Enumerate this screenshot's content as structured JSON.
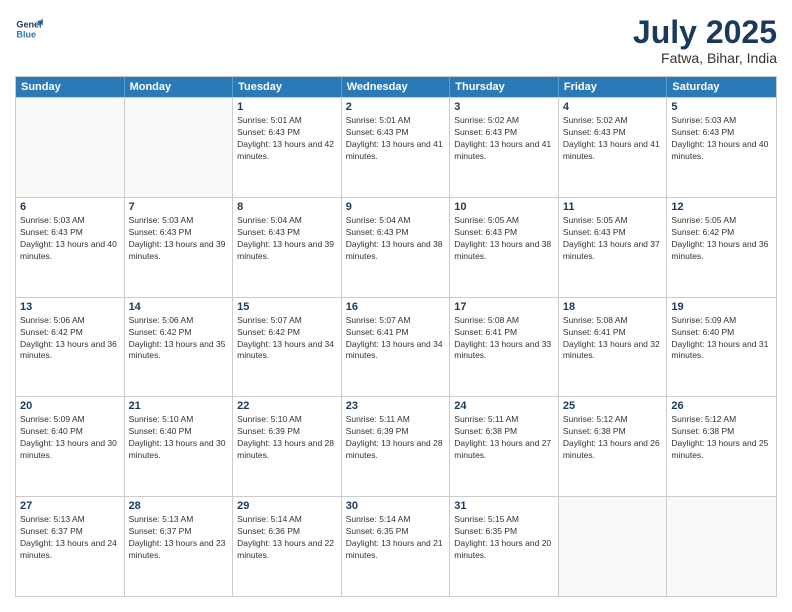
{
  "header": {
    "logo_general": "General",
    "logo_blue": "Blue",
    "month": "July 2025",
    "location": "Fatwa, Bihar, India"
  },
  "weekdays": [
    "Sunday",
    "Monday",
    "Tuesday",
    "Wednesday",
    "Thursday",
    "Friday",
    "Saturday"
  ],
  "rows": [
    [
      {
        "day": "",
        "sunrise": "",
        "sunset": "",
        "daylight": "",
        "empty": true
      },
      {
        "day": "",
        "sunrise": "",
        "sunset": "",
        "daylight": "",
        "empty": true
      },
      {
        "day": "1",
        "sunrise": "Sunrise: 5:01 AM",
        "sunset": "Sunset: 6:43 PM",
        "daylight": "Daylight: 13 hours and 42 minutes.",
        "empty": false
      },
      {
        "day": "2",
        "sunrise": "Sunrise: 5:01 AM",
        "sunset": "Sunset: 6:43 PM",
        "daylight": "Daylight: 13 hours and 41 minutes.",
        "empty": false
      },
      {
        "day": "3",
        "sunrise": "Sunrise: 5:02 AM",
        "sunset": "Sunset: 6:43 PM",
        "daylight": "Daylight: 13 hours and 41 minutes.",
        "empty": false
      },
      {
        "day": "4",
        "sunrise": "Sunrise: 5:02 AM",
        "sunset": "Sunset: 6:43 PM",
        "daylight": "Daylight: 13 hours and 41 minutes.",
        "empty": false
      },
      {
        "day": "5",
        "sunrise": "Sunrise: 5:03 AM",
        "sunset": "Sunset: 6:43 PM",
        "daylight": "Daylight: 13 hours and 40 minutes.",
        "empty": false
      }
    ],
    [
      {
        "day": "6",
        "sunrise": "Sunrise: 5:03 AM",
        "sunset": "Sunset: 6:43 PM",
        "daylight": "Daylight: 13 hours and 40 minutes.",
        "empty": false
      },
      {
        "day": "7",
        "sunrise": "Sunrise: 5:03 AM",
        "sunset": "Sunset: 6:43 PM",
        "daylight": "Daylight: 13 hours and 39 minutes.",
        "empty": false
      },
      {
        "day": "8",
        "sunrise": "Sunrise: 5:04 AM",
        "sunset": "Sunset: 6:43 PM",
        "daylight": "Daylight: 13 hours and 39 minutes.",
        "empty": false
      },
      {
        "day": "9",
        "sunrise": "Sunrise: 5:04 AM",
        "sunset": "Sunset: 6:43 PM",
        "daylight": "Daylight: 13 hours and 38 minutes.",
        "empty": false
      },
      {
        "day": "10",
        "sunrise": "Sunrise: 5:05 AM",
        "sunset": "Sunset: 6:43 PM",
        "daylight": "Daylight: 13 hours and 38 minutes.",
        "empty": false
      },
      {
        "day": "11",
        "sunrise": "Sunrise: 5:05 AM",
        "sunset": "Sunset: 6:43 PM",
        "daylight": "Daylight: 13 hours and 37 minutes.",
        "empty": false
      },
      {
        "day": "12",
        "sunrise": "Sunrise: 5:05 AM",
        "sunset": "Sunset: 6:42 PM",
        "daylight": "Daylight: 13 hours and 36 minutes.",
        "empty": false
      }
    ],
    [
      {
        "day": "13",
        "sunrise": "Sunrise: 5:06 AM",
        "sunset": "Sunset: 6:42 PM",
        "daylight": "Daylight: 13 hours and 36 minutes.",
        "empty": false
      },
      {
        "day": "14",
        "sunrise": "Sunrise: 5:06 AM",
        "sunset": "Sunset: 6:42 PM",
        "daylight": "Daylight: 13 hours and 35 minutes.",
        "empty": false
      },
      {
        "day": "15",
        "sunrise": "Sunrise: 5:07 AM",
        "sunset": "Sunset: 6:42 PM",
        "daylight": "Daylight: 13 hours and 34 minutes.",
        "empty": false
      },
      {
        "day": "16",
        "sunrise": "Sunrise: 5:07 AM",
        "sunset": "Sunset: 6:41 PM",
        "daylight": "Daylight: 13 hours and 34 minutes.",
        "empty": false
      },
      {
        "day": "17",
        "sunrise": "Sunrise: 5:08 AM",
        "sunset": "Sunset: 6:41 PM",
        "daylight": "Daylight: 13 hours and 33 minutes.",
        "empty": false
      },
      {
        "day": "18",
        "sunrise": "Sunrise: 5:08 AM",
        "sunset": "Sunset: 6:41 PM",
        "daylight": "Daylight: 13 hours and 32 minutes.",
        "empty": false
      },
      {
        "day": "19",
        "sunrise": "Sunrise: 5:09 AM",
        "sunset": "Sunset: 6:40 PM",
        "daylight": "Daylight: 13 hours and 31 minutes.",
        "empty": false
      }
    ],
    [
      {
        "day": "20",
        "sunrise": "Sunrise: 5:09 AM",
        "sunset": "Sunset: 6:40 PM",
        "daylight": "Daylight: 13 hours and 30 minutes.",
        "empty": false
      },
      {
        "day": "21",
        "sunrise": "Sunrise: 5:10 AM",
        "sunset": "Sunset: 6:40 PM",
        "daylight": "Daylight: 13 hours and 30 minutes.",
        "empty": false
      },
      {
        "day": "22",
        "sunrise": "Sunrise: 5:10 AM",
        "sunset": "Sunset: 6:39 PM",
        "daylight": "Daylight: 13 hours and 28 minutes.",
        "empty": false
      },
      {
        "day": "23",
        "sunrise": "Sunrise: 5:11 AM",
        "sunset": "Sunset: 6:39 PM",
        "daylight": "Daylight: 13 hours and 28 minutes.",
        "empty": false
      },
      {
        "day": "24",
        "sunrise": "Sunrise: 5:11 AM",
        "sunset": "Sunset: 6:38 PM",
        "daylight": "Daylight: 13 hours and 27 minutes.",
        "empty": false
      },
      {
        "day": "25",
        "sunrise": "Sunrise: 5:12 AM",
        "sunset": "Sunset: 6:38 PM",
        "daylight": "Daylight: 13 hours and 26 minutes.",
        "empty": false
      },
      {
        "day": "26",
        "sunrise": "Sunrise: 5:12 AM",
        "sunset": "Sunset: 6:38 PM",
        "daylight": "Daylight: 13 hours and 25 minutes.",
        "empty": false
      }
    ],
    [
      {
        "day": "27",
        "sunrise": "Sunrise: 5:13 AM",
        "sunset": "Sunset: 6:37 PM",
        "daylight": "Daylight: 13 hours and 24 minutes.",
        "empty": false
      },
      {
        "day": "28",
        "sunrise": "Sunrise: 5:13 AM",
        "sunset": "Sunset: 6:37 PM",
        "daylight": "Daylight: 13 hours and 23 minutes.",
        "empty": false
      },
      {
        "day": "29",
        "sunrise": "Sunrise: 5:14 AM",
        "sunset": "Sunset: 6:36 PM",
        "daylight": "Daylight: 13 hours and 22 minutes.",
        "empty": false
      },
      {
        "day": "30",
        "sunrise": "Sunrise: 5:14 AM",
        "sunset": "Sunset: 6:35 PM",
        "daylight": "Daylight: 13 hours and 21 minutes.",
        "empty": false
      },
      {
        "day": "31",
        "sunrise": "Sunrise: 5:15 AM",
        "sunset": "Sunset: 6:35 PM",
        "daylight": "Daylight: 13 hours and 20 minutes.",
        "empty": false
      },
      {
        "day": "",
        "sunrise": "",
        "sunset": "",
        "daylight": "",
        "empty": true
      },
      {
        "day": "",
        "sunrise": "",
        "sunset": "",
        "daylight": "",
        "empty": true
      }
    ]
  ]
}
